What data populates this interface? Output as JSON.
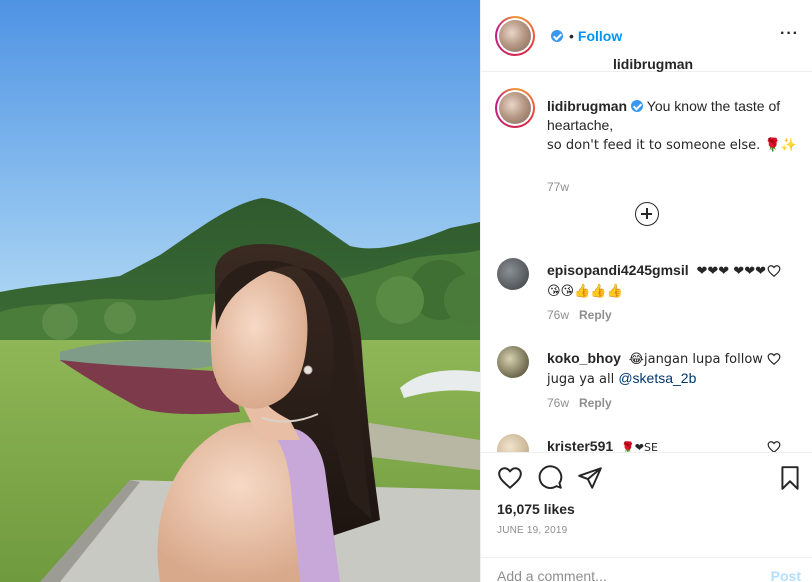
{
  "post": {
    "username": "lidibrugman",
    "verified": true,
    "follow_separator": "•",
    "follow_label": "Follow",
    "more_label": "···"
  },
  "caption": {
    "username": "lidibrugman",
    "line1": "You know the taste of heartache,",
    "line2": "so don't feed it to someone else. 🌹✨",
    "time": "77w"
  },
  "comments": [
    {
      "username": "episopandi4245gmsil",
      "text": "❤❤❤ ❤❤❤😘😘👍👍👍",
      "time": "76w",
      "reply_label": "Reply"
    },
    {
      "username": "koko_bhoy",
      "text_before": "😂jangan lupa follow juga ya all ",
      "mention": "@sketsa_2b",
      "time": "76w",
      "reply_label": "Reply"
    },
    {
      "username": "krister591",
      "text": "🌹❤SE"
    }
  ],
  "actions": {
    "likes": "16,075 likes",
    "date": "JUNE 19, 2019",
    "comment_placeholder": "Add a comment...",
    "post_label": "Post"
  },
  "colors": {
    "accent": "#0095f6",
    "text": "#262626",
    "muted": "#8e8e8e",
    "post_disabled": "#b2dffc"
  }
}
